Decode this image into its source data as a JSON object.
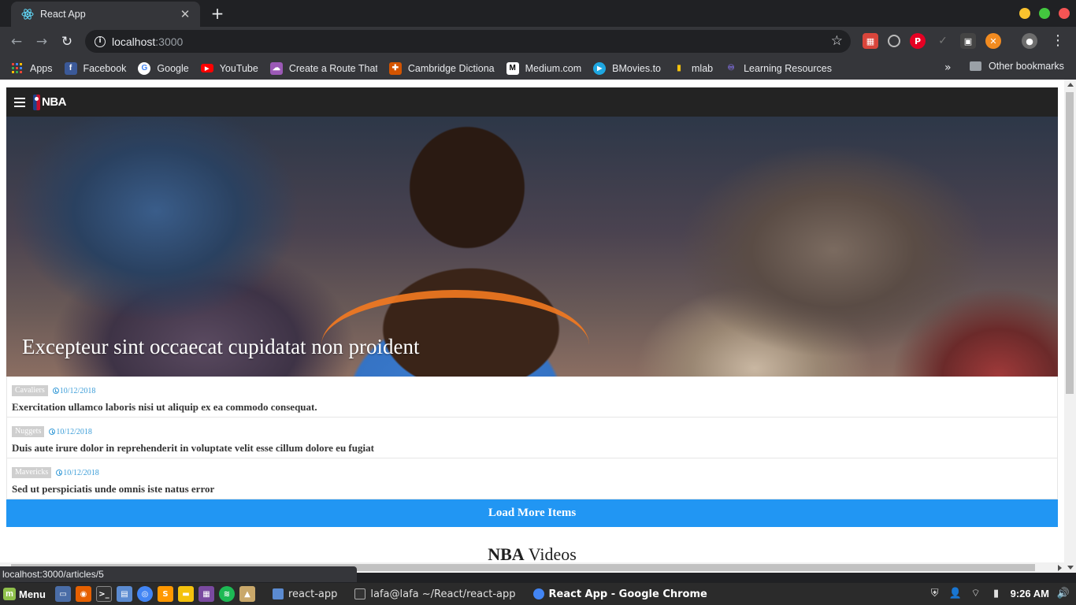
{
  "browser": {
    "tab": {
      "title": "React App",
      "close_label": "✕",
      "favicon": "react-icon"
    },
    "new_tab_label": "+",
    "address": {
      "host": "localhost",
      "port": ":3000"
    },
    "bookmarks": [
      {
        "label": "Apps",
        "icon": "apps-grid-icon",
        "color": "#e8eaed"
      },
      {
        "label": "Facebook",
        "icon": "facebook-icon",
        "color": "#3b5998"
      },
      {
        "label": "Google",
        "icon": "google-icon",
        "color": "#ffffff"
      },
      {
        "label": "YouTube",
        "icon": "youtube-icon",
        "color": "#ff0000"
      },
      {
        "label": "Create a Route That",
        "icon": "cloud-icon",
        "color": "#9b59b6"
      },
      {
        "label": "Cambridge Dictiona",
        "icon": "cambridge-icon",
        "color": "#d35400"
      },
      {
        "label": "Medium.com",
        "icon": "medium-icon",
        "color": "#ffffff"
      },
      {
        "label": "BMovies.to",
        "icon": "play-icon",
        "color": "#1ea7e1"
      },
      {
        "label": "mlab",
        "icon": "mlab-icon",
        "color": "#f4c20d"
      },
      {
        "label": "Learning Resources",
        "icon": "learning-icon",
        "color": "#7c6cd6"
      }
    ],
    "more_bookmarks": "»",
    "other_bookmarks": "Other bookmarks",
    "status_url": "localhost:3000/articles/5"
  },
  "app": {
    "logo_text": "NBA",
    "hero": {
      "caption": "Excepteur sint occaecat cupidatat non proident"
    },
    "news": [
      {
        "team": "Cavaliers",
        "date": "10/12/2018",
        "title": "Exercitation ullamco laboris nisi ut aliquip ex ea commodo consequat."
      },
      {
        "team": "Nuggets",
        "date": "10/12/2018",
        "title": "Duis aute irure dolor in reprehenderit in voluptate velit esse cillum dolore eu fugiat"
      },
      {
        "team": "Mavericks",
        "date": "10/12/2018",
        "title": "Sed ut perspiciatis unde omnis iste natus error"
      }
    ],
    "load_more_label": "Load More Items",
    "videos_heading": {
      "bold": "NBA",
      "rest": " Videos"
    }
  },
  "taskbar": {
    "menu_label": "Menu",
    "tasks": [
      {
        "label": "react-app",
        "icon": "folder-icon",
        "active": false
      },
      {
        "label": "lafa@lafa ~/React/react-app",
        "icon": "terminal-icon",
        "active": false
      },
      {
        "label": "React App - Google Chrome",
        "icon": "chrome-icon",
        "active": true
      }
    ],
    "time": "9:26 AM"
  },
  "colors": {
    "accent_blue": "#2196f3",
    "date_blue": "#3b9dd8",
    "header_dark": "#232323"
  }
}
